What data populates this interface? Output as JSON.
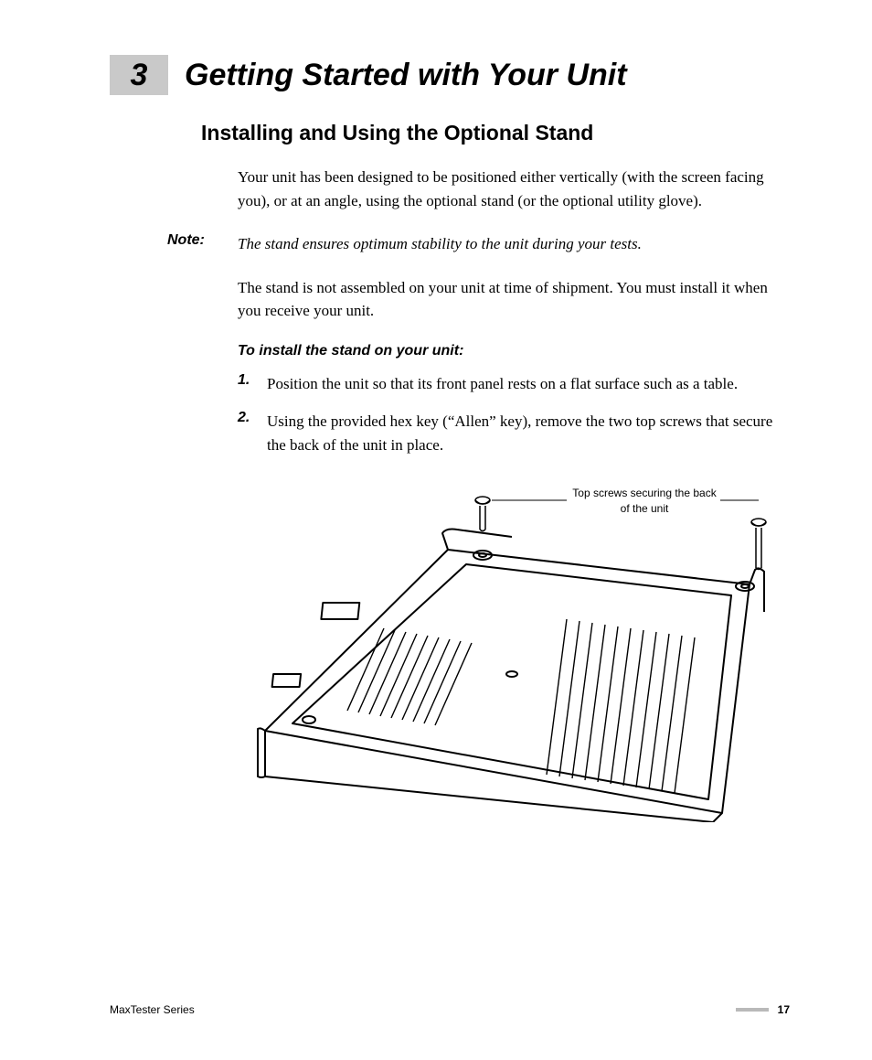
{
  "chapter": {
    "number": "3",
    "title": "Getting Started with Your Unit"
  },
  "section": {
    "title": "Installing and Using the Optional Stand"
  },
  "paragraphs": {
    "intro": "Your unit has been designed to be positioned either vertically (with the screen facing you), or at an angle, using the optional stand (or the optional utility glove).",
    "after_note": "The stand is not assembled on your unit at time of shipment. You must install it when you receive your unit."
  },
  "note": {
    "label": "Note:",
    "text": "The stand ensures optimum stability to the unit during your tests."
  },
  "instructions": {
    "heading": "To install the stand on your unit:",
    "steps": [
      {
        "num": "1.",
        "text": "Position the unit so that its front panel rests on a flat surface such as a table."
      },
      {
        "num": "2.",
        "text": "Using the provided hex key (“Allen” key), remove the two top screws that secure the back of the unit in place."
      }
    ]
  },
  "figure": {
    "callout": "Top screws securing the back of the unit"
  },
  "footer": {
    "left": "MaxTester Series",
    "page": "17"
  }
}
